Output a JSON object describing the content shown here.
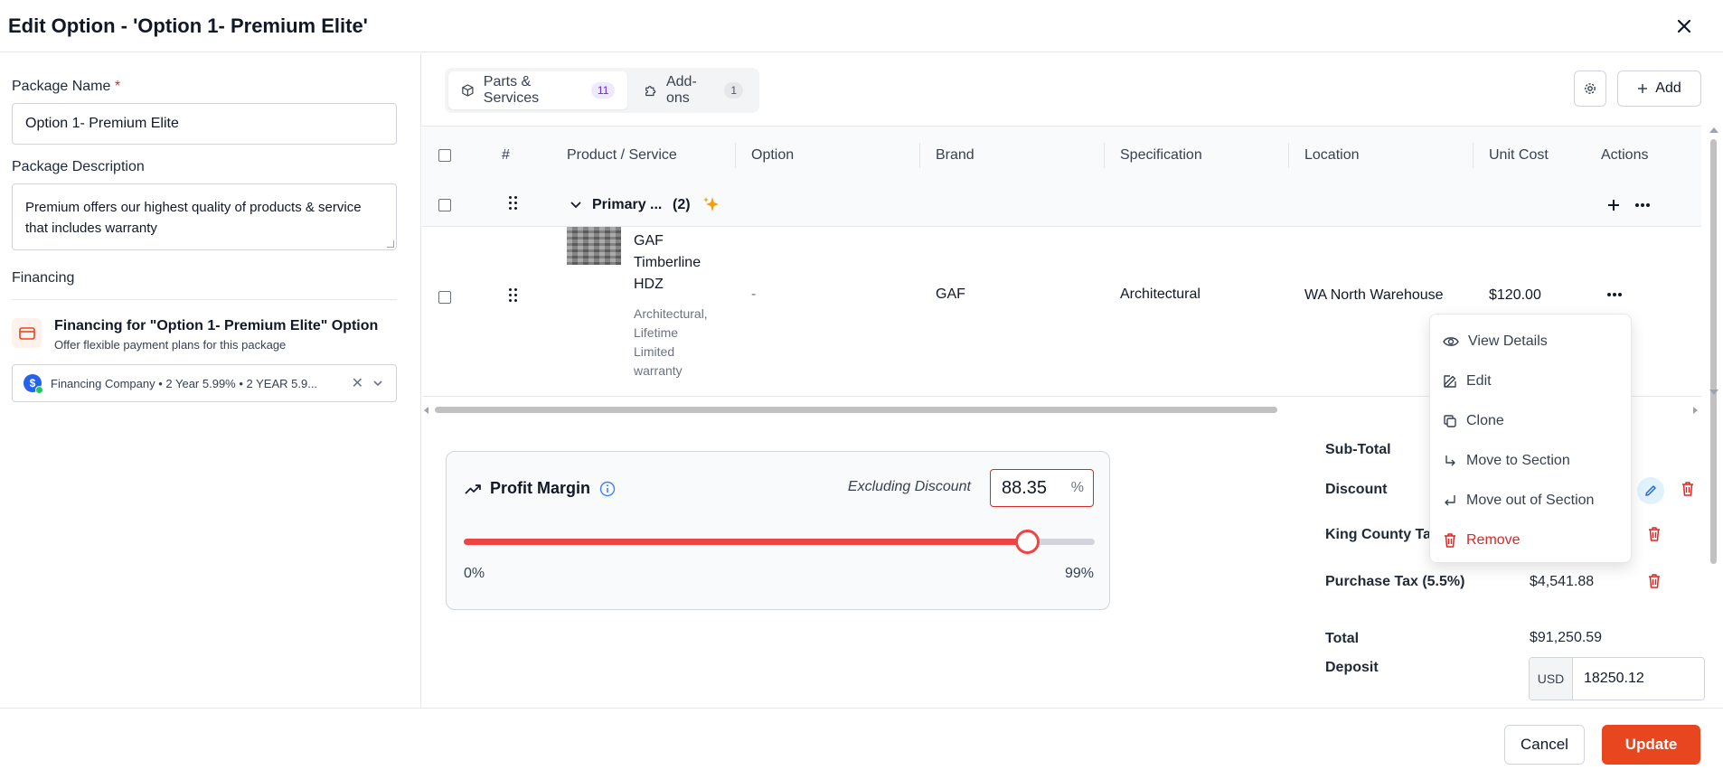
{
  "dialog": {
    "title": "Edit Option - 'Option 1- Premium Elite'"
  },
  "form": {
    "package_name_label": "Package Name",
    "required_mark": "*",
    "package_name_value": "Option 1- Premium Elite",
    "package_description_label": "Package Description",
    "package_description_value": "Premium offers our highest quality of products & service that includes warranty",
    "financing_label": "Financing",
    "financing_card_title": "Financing for \"Option 1- Premium Elite\" Option",
    "financing_card_subtitle": "Offer flexible payment plans for this package",
    "financing_select_value": "Financing Company • 2 Year 5.99% • 2 YEAR 5.9..."
  },
  "tabs": [
    {
      "label": "Parts & Services",
      "count": "11",
      "active": true
    },
    {
      "label": "Add-ons",
      "count": "1",
      "active": false
    }
  ],
  "toolbar": {
    "add_label": "Add"
  },
  "table": {
    "columns": [
      "#",
      "Product / Service",
      "Option",
      "Brand",
      "Specification",
      "Location",
      "Unit Cost",
      "Actions"
    ],
    "group": {
      "name": "Primary ...",
      "count": "(2)"
    },
    "rows": [
      {
        "name_line1": "GAF",
        "name_line2": "Timberline",
        "name_line3": "HDZ",
        "desc_line1": "Architectural,",
        "desc_line2": "Lifetime",
        "desc_line3": "Limited",
        "desc_line4": "warranty",
        "option": "-",
        "brand": "GAF",
        "specification": "Architectural",
        "location": "WA North Warehouse",
        "unit_cost": "$120.00"
      }
    ]
  },
  "context_menu": {
    "items": [
      {
        "label": "View Details",
        "icon": "eye-icon"
      },
      {
        "label": "Edit",
        "icon": "pencil-icon"
      },
      {
        "label": "Clone",
        "icon": "copy-icon"
      },
      {
        "label": "Move to Section",
        "icon": "arrow-down-right-icon"
      },
      {
        "label": "Move out of Section",
        "icon": "arrow-return-icon"
      },
      {
        "label": "Remove",
        "icon": "trash-icon"
      }
    ]
  },
  "profit_margin": {
    "title": "Profit Margin",
    "excluding_label": "Excluding Discount",
    "value": "88.35",
    "unit": "%",
    "min_label": "0%",
    "max_label": "99%",
    "slider_fraction": 0.8924
  },
  "summary": {
    "subtotal_label": "Sub-Total",
    "discount_label": "Discount",
    "king_county_label": "King County Ta",
    "purchase_tax_label": "Purchase Tax (5.5%)",
    "purchase_tax_value": "$4,541.88",
    "total_label": "Total",
    "total_value": "$91,250.59",
    "deposit_label": "Deposit",
    "deposit_currency": "USD",
    "deposit_value": "18250.12"
  },
  "footer": {
    "cancel_label": "Cancel",
    "update_label": "Update"
  },
  "colors": {
    "accent": "#e8461f",
    "danger": "#dc2626",
    "slider": "#ef4444",
    "tab_badge": "#6d28d9"
  }
}
